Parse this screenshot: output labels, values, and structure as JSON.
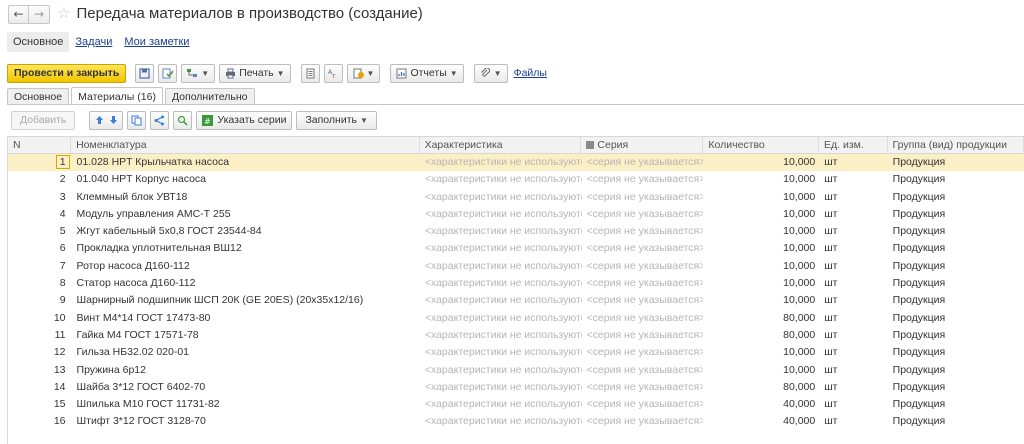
{
  "window": {
    "title": "Передача материалов в производство (создание)"
  },
  "sections": {
    "main": "Основное",
    "tasks": "Задачи",
    "notes": "Мои заметки"
  },
  "toolbar": {
    "post_close": "Провести и закрыть",
    "print": "Печать",
    "reports": "Отчеты",
    "files": "Файлы"
  },
  "tabs": [
    {
      "label": "Основное",
      "active": false
    },
    {
      "label": "Материалы (16)",
      "active": true
    },
    {
      "label": "Дополнительно",
      "active": false
    }
  ],
  "table_toolbar": {
    "add": "Добавить",
    "specify_series": "Указать серии",
    "fill": "Заполнить"
  },
  "table": {
    "columns": {
      "n": "N",
      "name": "Номенклатура",
      "characteristic": "Характеристика",
      "series": "Серия",
      "qty": "Количество",
      "unit": "Ед. изм.",
      "group": "Группа (вид) продукции"
    },
    "rows": [
      {
        "n": "1",
        "name": "01.028 HPT Крыльчатка насоса",
        "char": "<характеристики не используются>",
        "series": "<серия не указывается>",
        "qty": "10,000",
        "unit": "шт",
        "group": "Продукция"
      },
      {
        "n": "2",
        "name": "01.040 HPT Корпус насоса",
        "char": "<характеристики не используются>",
        "series": "<серия не указывается>",
        "qty": "10,000",
        "unit": "шт",
        "group": "Продукция"
      },
      {
        "n": "3",
        "name": "Клеммный блок УВТ18",
        "char": "<характеристики не используются>",
        "series": "<серия не указывается>",
        "qty": "10,000",
        "unit": "шт",
        "group": "Продукция"
      },
      {
        "n": "4",
        "name": "Модуль управления АМС-Т 255",
        "char": "<характеристики не используются>",
        "series": "<серия не указывается>",
        "qty": "10,000",
        "unit": "шт",
        "group": "Продукция"
      },
      {
        "n": "5",
        "name": "Жгут кабельный 5х0,8 ГОСТ 23544-84",
        "char": "<характеристики не используются>",
        "series": "<серия не указывается>",
        "qty": "10,000",
        "unit": "шт",
        "group": "Продукция"
      },
      {
        "n": "6",
        "name": "Прокладка уплотнительная ВШ12",
        "char": "<характеристики не используются>",
        "series": "<серия не указывается>",
        "qty": "10,000",
        "unit": "шт",
        "group": "Продукция"
      },
      {
        "n": "7",
        "name": "Ротор насоса Д160-112",
        "char": "<характеристики не используются>",
        "series": "<серия не указывается>",
        "qty": "10,000",
        "unit": "шт",
        "group": "Продукция"
      },
      {
        "n": "8",
        "name": "Статор насоса Д160-112",
        "char": "<характеристики не используются>",
        "series": "<серия не указывается>",
        "qty": "10,000",
        "unit": "шт",
        "group": "Продукция"
      },
      {
        "n": "9",
        "name": "Шарнирный подшипник ШСП 20К (GE 20ES) (20х35х12/16)",
        "char": "<характеристики не используются>",
        "series": "<серия не указывается>",
        "qty": "10,000",
        "unit": "шт",
        "group": "Продукция"
      },
      {
        "n": "10",
        "name": "Винт М4*14 ГОСТ 17473-80",
        "char": "<характеристики не используются>",
        "series": "<серия не указывается>",
        "qty": "80,000",
        "unit": "шт",
        "group": "Продукция"
      },
      {
        "n": "11",
        "name": "Гайка М4 ГОСТ 17571-78",
        "char": "<характеристики не используются>",
        "series": "<серия не указывается>",
        "qty": "80,000",
        "unit": "шт",
        "group": "Продукция"
      },
      {
        "n": "12",
        "name": "Гильза НБ32.02 020-01",
        "char": "<характеристики не используются>",
        "series": "<серия не указывается>",
        "qty": "10,000",
        "unit": "шт",
        "group": "Продукция"
      },
      {
        "n": "13",
        "name": "Пружина 6р12",
        "char": "<характеристики не используются>",
        "series": "<серия не указывается>",
        "qty": "10,000",
        "unit": "шт",
        "group": "Продукция"
      },
      {
        "n": "14",
        "name": "Шайба 3*12 ГОСТ 6402-70",
        "char": "<характеристики не используются>",
        "series": "<серия не указывается>",
        "qty": "80,000",
        "unit": "шт",
        "group": "Продукция"
      },
      {
        "n": "15",
        "name": "Шпилька М10 ГОСТ 11731-82",
        "char": "<характеристики не используются>",
        "series": "<серия не указывается>",
        "qty": "40,000",
        "unit": "шт",
        "group": "Продукция"
      },
      {
        "n": "16",
        "name": "Штифт 3*12 ГОСТ 3128-70",
        "char": "<характеристики не используются>",
        "series": "<серия не указывается>",
        "qty": "40,000",
        "unit": "шт",
        "group": "Продукция"
      }
    ]
  },
  "colors": {
    "accent_yellow": "#f5c800",
    "selected_row": "#fbefc5",
    "link": "#1c3e94"
  }
}
